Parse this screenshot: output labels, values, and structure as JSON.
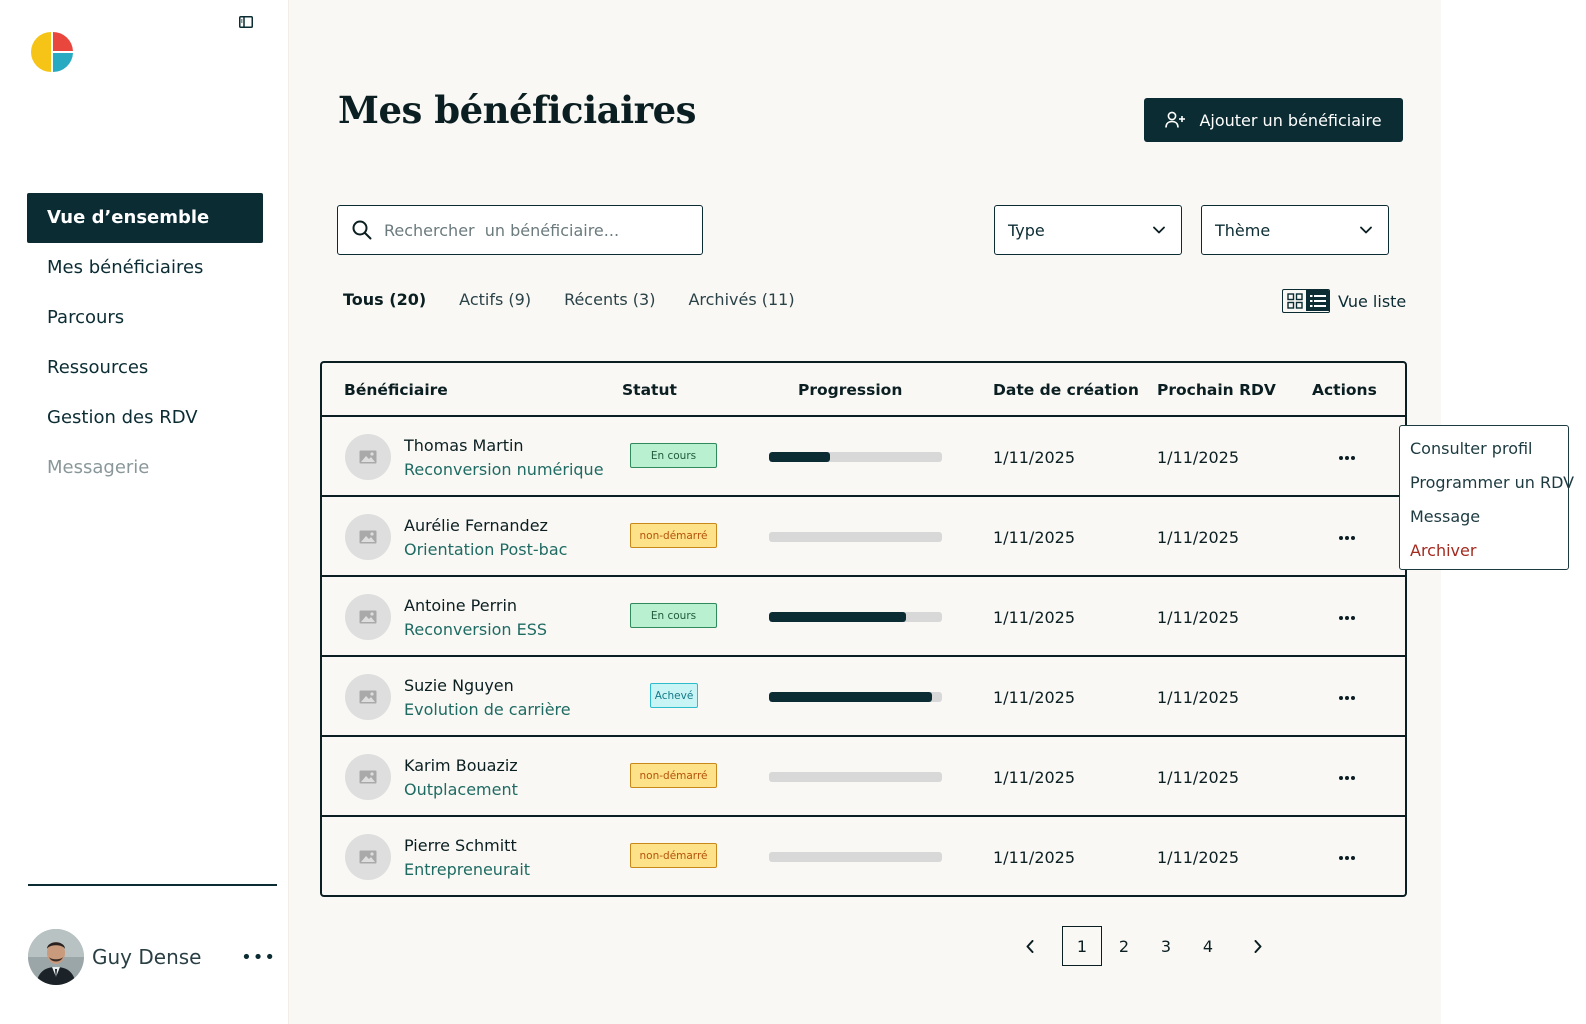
{
  "sidebar": {
    "nav": [
      {
        "label": "Vue d’ensemble",
        "active": true
      },
      {
        "label": "Mes bénéficiaires"
      },
      {
        "label": "Parcours"
      },
      {
        "label": "Ressources"
      },
      {
        "label": "Gestion des RDV"
      },
      {
        "label": "Messagerie",
        "muted": true
      }
    ],
    "user": {
      "name": "Guy Dense",
      "menu": "•••"
    }
  },
  "header": {
    "title": "Mes bénéficiaires",
    "add_button": "Ajouter un bénéficiaire"
  },
  "filters": {
    "search_placeholder": "Rechercher  un bénéficiaire...",
    "type_label": "Type",
    "theme_label": "Thème"
  },
  "tabs": [
    {
      "label": "Tous (20)",
      "active": true
    },
    {
      "label": "Actifs (9)"
    },
    {
      "label": "Récents (3)"
    },
    {
      "label": "Archivés (11)"
    }
  ],
  "view_toggle": {
    "label": "Vue liste"
  },
  "table": {
    "headers": {
      "beneficiary": "Bénéficiaire",
      "status": "Statut",
      "progress": "Progression",
      "created": "Date de création",
      "next": "Prochain RDV",
      "actions": "Actions"
    },
    "rows": [
      {
        "name": "Thomas Martin",
        "track": "Reconversion numérique",
        "status": "En cours",
        "status_kind": "encours",
        "progress": 0.35,
        "created": "1/11/2025",
        "next": "1/11/2025"
      },
      {
        "name": "Aurélie Fernandez",
        "track": "Orientation Post-bac",
        "status": "non-démarré",
        "status_kind": "nondem",
        "progress": 0,
        "created": "1/11/2025",
        "next": "1/11/2025"
      },
      {
        "name": "Antoine Perrin",
        "track": "Reconversion ESS",
        "status": "En cours",
        "status_kind": "encours",
        "progress": 0.79,
        "created": "1/11/2025",
        "next": "1/11/2025"
      },
      {
        "name": "Suzie Nguyen",
        "track": "Evolution de carrière",
        "status": "Achevé",
        "status_kind": "acheve",
        "progress": 0.94,
        "created": "1/11/2025",
        "next": "1/11/2025"
      },
      {
        "name": "Karim Bouaziz",
        "track": "Outplacement",
        "status": "non-démarré",
        "status_kind": "nondem",
        "progress": 0,
        "created": "1/11/2025",
        "next": "1/11/2025"
      },
      {
        "name": "Pierre Schmitt",
        "track": "Entrepreneurait",
        "status": "non-démarré",
        "status_kind": "nondem",
        "progress": 0,
        "created": "1/11/2025",
        "next": "1/11/2025"
      }
    ]
  },
  "context_menu": {
    "items": [
      {
        "label": "Consulter profil"
      },
      {
        "label": "Programmer un RDV"
      },
      {
        "label": "Message"
      },
      {
        "label": "Archiver",
        "danger": true
      }
    ]
  },
  "pagination": {
    "pages": [
      "1",
      "2",
      "3",
      "4"
    ],
    "current": "1"
  },
  "colors": {
    "primary": "#0b2c33",
    "background": "#faf8f4",
    "accent_text": "#1f6b63",
    "danger": "#a32a1f"
  },
  "icons": [
    "sidebar-toggle-icon",
    "user-plus-icon",
    "search-icon",
    "chevron-down-icon",
    "grid-view-icon",
    "list-view-icon",
    "image-placeholder-icon",
    "more-icon",
    "chevron-left-icon",
    "chevron-right-icon"
  ]
}
